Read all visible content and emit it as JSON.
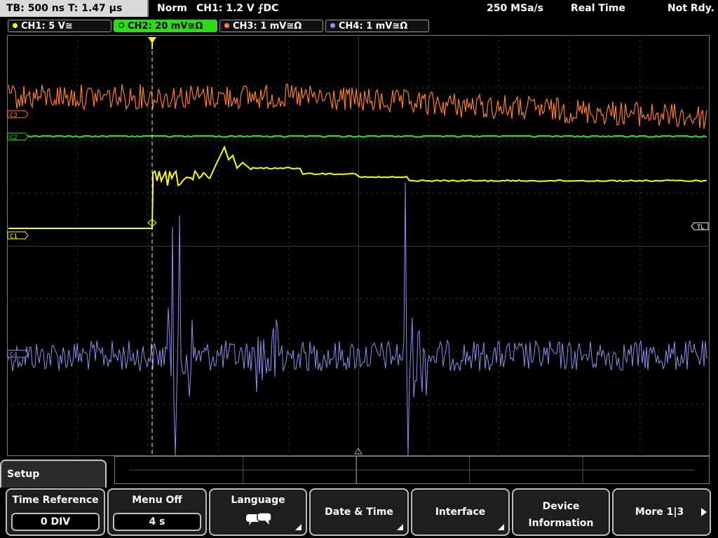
{
  "status": {
    "timebase": "TB: 500 ns  T: 1.47 µs",
    "mode": "Norm",
    "trigger": "CH1: 1.2 V ⨍DC",
    "sample_rate": "250 MSa/s",
    "acq_mode": "Real Time",
    "state": "Not Rdy."
  },
  "channels": [
    {
      "label": "CH1: 5 V≅",
      "color": "#ffff00"
    },
    {
      "label": "CH2: 20 mV≅Ω",
      "color": "#2bdc17"
    },
    {
      "label": "CH3: 1 mV≅Ω",
      "color": "#ff7f27"
    },
    {
      "label": "CH4: 1 mV≅Ω",
      "color": "#8f8fef"
    }
  ],
  "markers": {
    "c1": "C1",
    "c2": "C2",
    "c3": "C3",
    "c4": "C4",
    "trigger_level": "TL"
  },
  "menu": {
    "title": "Setup",
    "softkeys": [
      {
        "label": "Time Reference",
        "value": "0 DIV"
      },
      {
        "label": "Menu Off",
        "value": "4 s"
      },
      {
        "label": "Language",
        "icon": "speech-bubbles-icon"
      },
      {
        "label": "Date & Time"
      },
      {
        "label": "Interface"
      },
      {
        "label": "Device\nInformation"
      },
      {
        "label": "More 1|3"
      }
    ]
  }
}
